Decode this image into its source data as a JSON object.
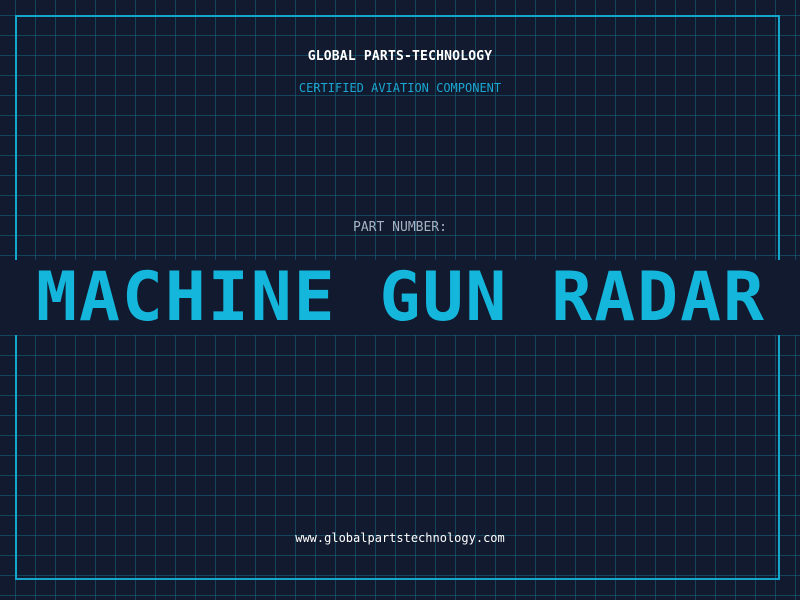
{
  "header": {
    "company": "GLOBAL PARTS-TECHNOLOGY",
    "subtitle": "CERTIFIED AVIATION COMPONENT"
  },
  "part": {
    "label": "PART NUMBER:",
    "number": "MACHINE GUN RADAR"
  },
  "footer": {
    "website": "www.globalpartstechnology.com"
  },
  "colors": {
    "background": "#111a2e",
    "grid": "#186880",
    "accent": "#15b6dc",
    "frame": "#15a6cc",
    "label": "#a7b3c4",
    "text": "#ffffff"
  }
}
